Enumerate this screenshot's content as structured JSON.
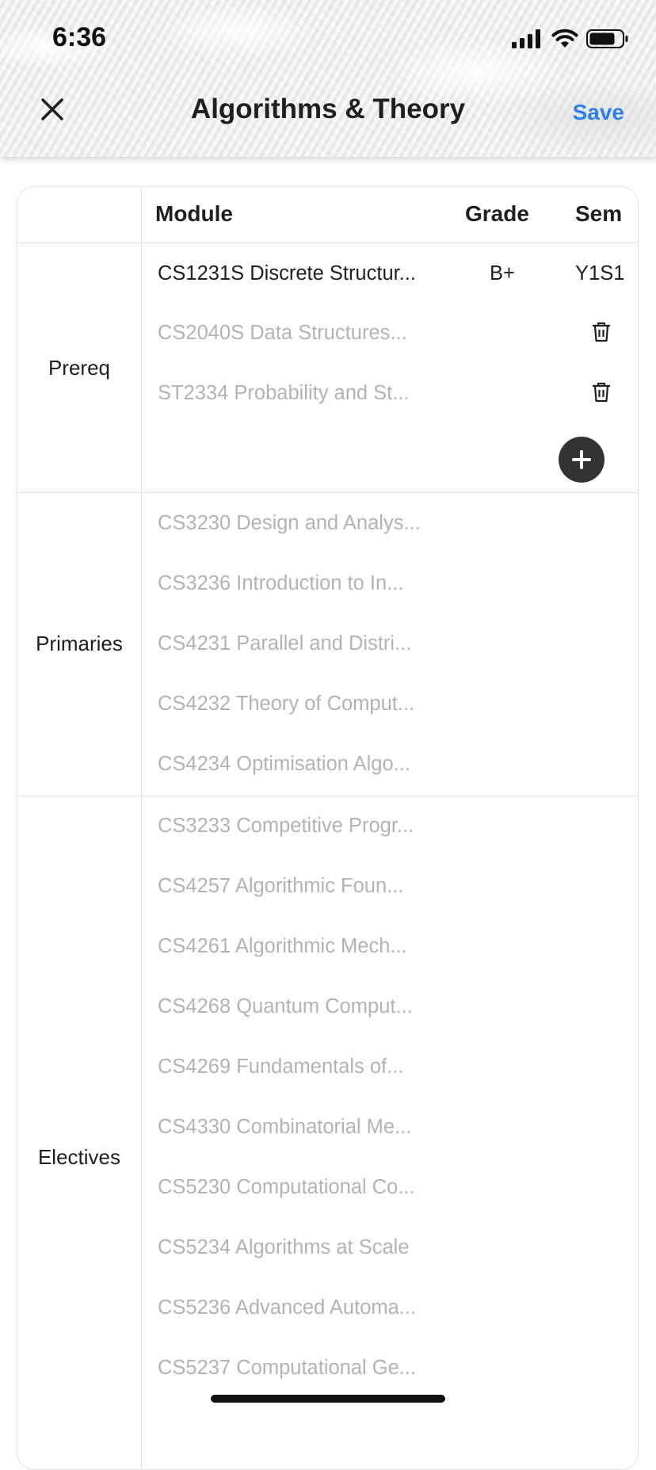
{
  "status_bar": {
    "time": "6:36"
  },
  "header": {
    "title": "Algorithms & Theory",
    "save_label": "Save"
  },
  "table": {
    "columns": {
      "module": "Module",
      "grade": "Grade",
      "sem": "Sem"
    },
    "sections": [
      {
        "label": "Prereq",
        "rows": [
          {
            "module": "CS1231S Discrete Structur...",
            "grade": "B+",
            "sem": "Y1S1",
            "taken": true
          },
          {
            "module": "CS2040S Data Structures...",
            "grade": "",
            "sem": "",
            "taken": false
          },
          {
            "module": "ST2334 Probability and St...",
            "grade": "",
            "sem": "",
            "taken": false
          }
        ]
      },
      {
        "label": "Primaries",
        "rows": [
          {
            "module": "CS3230 Design and Analys..."
          },
          {
            "module": "CS3236 Introduction to In..."
          },
          {
            "module": "CS4231 Parallel and Distri..."
          },
          {
            "module": "CS4232 Theory of Comput..."
          },
          {
            "module": "CS4234 Optimisation Algo..."
          }
        ]
      },
      {
        "label": "Electives",
        "rows": [
          {
            "module": "CS3233 Competitive Progr..."
          },
          {
            "module": "CS4257 Algorithmic Foun..."
          },
          {
            "module": "CS4261 Algorithmic Mech..."
          },
          {
            "module": "CS4268 Quantum Comput..."
          },
          {
            "module": "CS4269 Fundamentals of..."
          },
          {
            "module": "CS4330 Combinatorial Me..."
          },
          {
            "module": "CS5230 Computational Co..."
          },
          {
            "module": "CS5234 Algorithms at Scale"
          },
          {
            "module": "CS5236 Advanced Automa..."
          },
          {
            "module": "CS5237 Computational Ge..."
          }
        ]
      }
    ]
  },
  "icons": {
    "close": "close-icon",
    "trash": "trash-icon",
    "add": "plus-icon",
    "signal": "cellular-signal-icon",
    "wifi": "wifi-icon",
    "battery": "battery-icon"
  },
  "colors": {
    "accent": "#2f80ed",
    "muted_text": "#b3b3b3",
    "add_button": "#333333"
  }
}
